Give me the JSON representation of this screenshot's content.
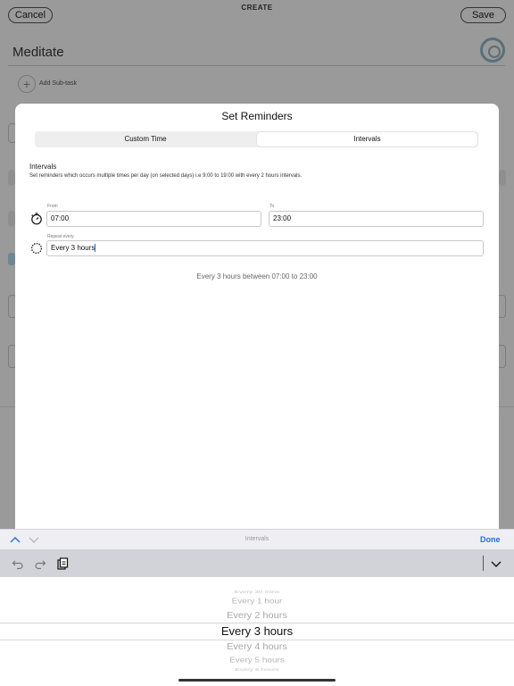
{
  "header": {
    "title": "CREATE",
    "cancel_label": "Cancel",
    "save_label": "Save"
  },
  "task": {
    "name": "Meditate",
    "add_subtask_label": "Add Sub-task"
  },
  "modal": {
    "title": "Set Reminders",
    "tabs": [
      {
        "label": "Custom Time",
        "selected": false
      },
      {
        "label": "Intervals",
        "selected": true
      }
    ],
    "section_title": "Intervals",
    "section_description": "Set reminders which occurs multiple times per day (on selected days) i.e 9:00 to 19:00 with every 2 hours intervals.",
    "from_label": "From",
    "from_value": "07:00",
    "to_label": "To",
    "to_value": "23:00",
    "repeat_label": "Repeat every",
    "repeat_value": "Every 3 hours",
    "summary": "Every 3 hours between 07:00 to 23:00"
  },
  "accessory_bar": {
    "title": "Intervals",
    "done_label": "Done"
  },
  "picker": {
    "options": [
      "Every 30 mins",
      "Every 1 hour",
      "Every 2 hours",
      "Every 3 hours",
      "Every 4 hours",
      "Every 5 hours",
      "Every 6 hours"
    ],
    "selected": "Every 3 hours"
  },
  "colors": {
    "accent": "#1b6fe0",
    "dim_background": "#9a9a9a",
    "modal_background": "#ffffff"
  },
  "icons": {
    "clock": "timer-icon",
    "repeat": "repeat-dashed-circle-icon",
    "undo": "undo-icon",
    "redo": "redo-icon",
    "paste": "clipboard-icon",
    "dismiss": "chevron-down-icon"
  }
}
